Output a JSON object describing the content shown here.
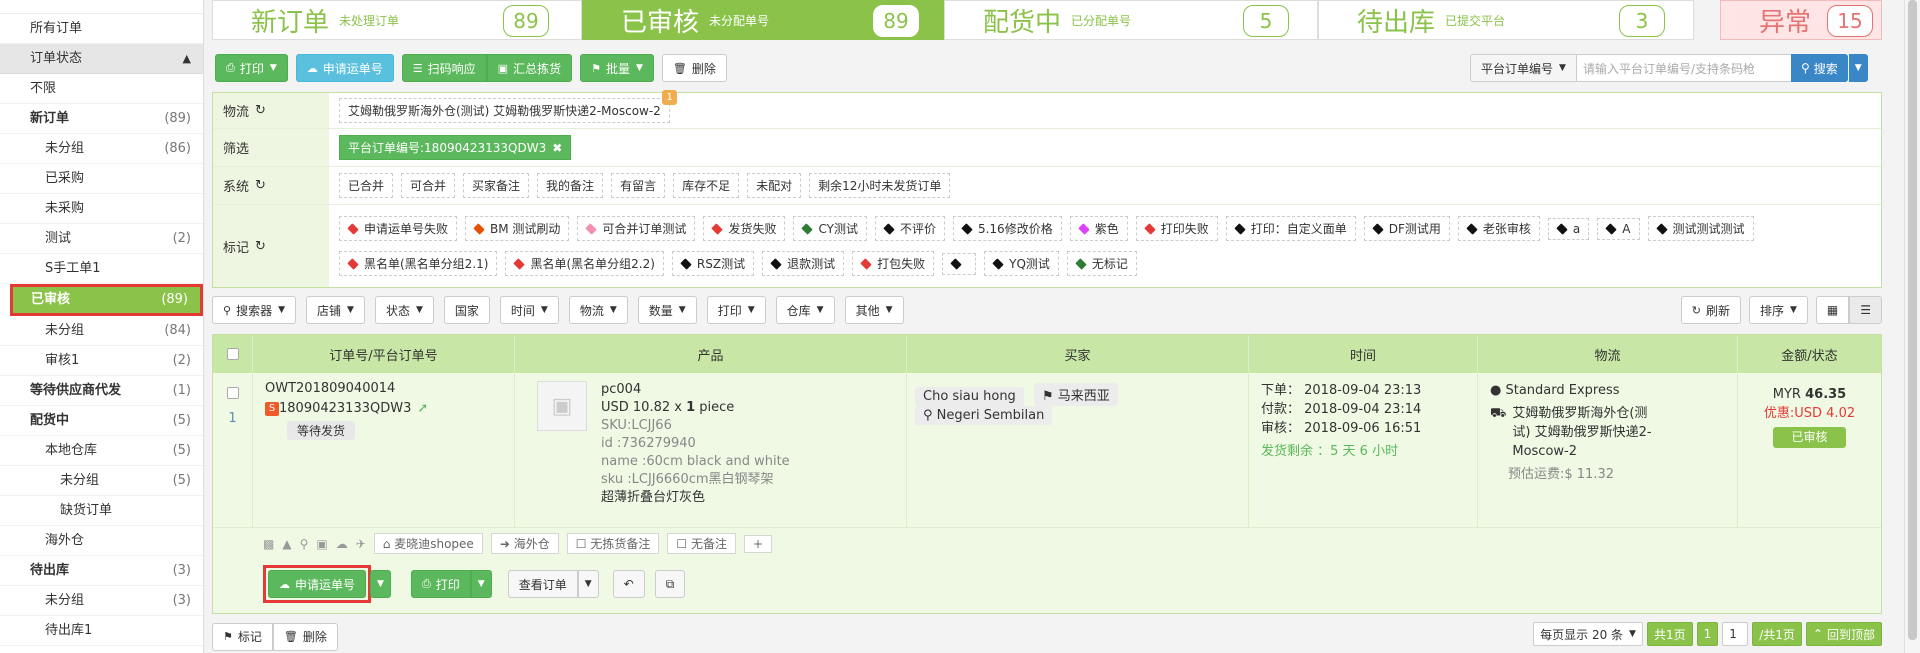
{
  "sidebar": {
    "all_orders": "所有订单",
    "status_header": "订单状态",
    "items": [
      {
        "label": "不限",
        "count": ""
      },
      {
        "label": "新订单",
        "count": "(89)"
      },
      {
        "label": "未分组",
        "count": "(86)"
      },
      {
        "label": "已采购",
        "count": ""
      },
      {
        "label": "未采购",
        "count": ""
      },
      {
        "label": "测试",
        "count": "(2)"
      },
      {
        "label": "S手工单1",
        "count": ""
      },
      {
        "label": "已审核",
        "count": "(89)"
      },
      {
        "label": "未分组",
        "count": "(84)"
      },
      {
        "label": "审核1",
        "count": "(2)"
      },
      {
        "label": "等待供应商代发",
        "count": "(1)"
      },
      {
        "label": "配货中",
        "count": "(5)"
      },
      {
        "label": "本地仓库",
        "count": "(5)"
      },
      {
        "label": "未分组",
        "count": "(5)"
      },
      {
        "label": "缺货订单",
        "count": ""
      },
      {
        "label": "海外仓",
        "count": ""
      },
      {
        "label": "待出库",
        "count": "(3)"
      },
      {
        "label": "未分组",
        "count": "(3)"
      },
      {
        "label": "待出库1",
        "count": ""
      }
    ]
  },
  "tabs": [
    {
      "name": "新订单",
      "sub": "未处理订单",
      "count": "89"
    },
    {
      "name": "已审核",
      "sub": "未分配单号",
      "count": "89"
    },
    {
      "name": "配货中",
      "sub": "已分配单号",
      "count": "5"
    },
    {
      "name": "待出库",
      "sub": "已提交平台",
      "count": "3"
    },
    {
      "name": "异常",
      "sub": "",
      "count": "15"
    }
  ],
  "toolbar": {
    "print": "打印",
    "apply_tracking": "申请运单号",
    "scan_response": "扫码响应",
    "summary_pick": "汇总拣货",
    "batch": "批量",
    "delete": "删除"
  },
  "search": {
    "select_label": "平台订单编号",
    "placeholder": "请输入平台订单编号/支持条码枪",
    "button": "搜索"
  },
  "filters": {
    "logistics_label": "物流",
    "logistics_item": "艾姆勒俄罗斯海外仓(测试) 艾姆勒俄罗斯快递2-Moscow-2",
    "logistics_badge": "1",
    "filter_label": "筛选",
    "filter_selected": "平台订单编号:18090423133QDW3",
    "system_label": "系统",
    "system_items": [
      "已合并",
      "可合并",
      "买家备注",
      "我的备注",
      "有留言",
      "库存不足",
      "未配对",
      "剩余12小时未发货订单"
    ],
    "mark_label": "标记",
    "marks": [
      {
        "text": "申请运单号失败",
        "color": "#e53935"
      },
      {
        "text": "BM 测试刷动",
        "color": "#e65100"
      },
      {
        "text": "可合并订单测试",
        "color": "#f48fb1"
      },
      {
        "text": "发货失败",
        "color": "#e53935"
      },
      {
        "text": "CY测试",
        "color": "#2e7d32"
      },
      {
        "text": "不评价",
        "color": "#111111"
      },
      {
        "text": "5.16修改价格",
        "color": "#111111"
      },
      {
        "text": "紫色",
        "color": "#e040fb"
      },
      {
        "text": "打印失败",
        "color": "#e53935"
      },
      {
        "text": "打印：自定义面单",
        "color": "#111111"
      },
      {
        "text": "DF测试用",
        "color": "#111111"
      },
      {
        "text": "老张审核",
        "color": "#111111"
      },
      {
        "text": "a",
        "color": "#111111"
      },
      {
        "text": "A",
        "color": "#111111"
      },
      {
        "text": "测试测试测试",
        "color": "#111111"
      },
      {
        "text": "黑名单(黑名单分组2.1)",
        "color": "#e53935"
      },
      {
        "text": "黑名单(黑名单分组2.2)",
        "color": "#e53935"
      },
      {
        "text": "RSZ测试",
        "color": "#111111"
      },
      {
        "text": "退款测试",
        "color": "#111111"
      },
      {
        "text": "打包失败",
        "color": "#e53935"
      },
      {
        "text": "",
        "color": "#111111"
      },
      {
        "text": "YQ测试",
        "color": "#111111"
      },
      {
        "text": "无标记",
        "color": "#2e7d32"
      }
    ]
  },
  "filterbar": {
    "items": [
      "搜索器",
      "店铺",
      "状态",
      "国家",
      "时间",
      "物流",
      "数量",
      "打印",
      "仓库",
      "其他"
    ],
    "refresh": "刷新",
    "sort": "排序"
  },
  "table": {
    "headers": [
      "订单号/平台订单号",
      "产品",
      "买家",
      "时间",
      "物流",
      "金额/状态"
    ],
    "row": {
      "index": "1",
      "order_no": "OWT201809040014",
      "platform_no": "18090423133QDW3",
      "status_pill": "等待发货",
      "product_sku_name": "pc004",
      "price_line": "USD 10.82 x",
      "qty": "1",
      "qty_unit": "piece",
      "sku": "SKU:LCJJ66",
      "id": "id :736279940",
      "name": "name :60cm black and white",
      "sku_detail": "sku :LCJJ6660cm黑白钢琴架",
      "product_title": "超薄折叠台灯灰色",
      "buyer_name": "Cho siau hong",
      "buyer_country": "马来西亚",
      "buyer_state": "Negeri Sembilan",
      "time_order": "下单： 2018-09-04 23:13",
      "time_paid": "付款： 2018-09-04 23:14",
      "time_audit": "审核： 2018-09-06 16:51",
      "time_remaining": "发货剩余 ：5 天 6 小时",
      "shipping_method": "Standard Express",
      "logistics_detail": "艾姆勒俄罗斯海外仓(测试) 艾姆勒俄罗斯快递2-Moscow-2",
      "estimated_fee": "预估运费:$ 11.32",
      "amount_currency": "MYR",
      "amount": "46.35",
      "discount": "优惠:USD 4.02",
      "status": "已审核",
      "shop_tag": "麦晓迪shopee",
      "warehouse_tag": "海外仓",
      "no_pick_note": "无拣货备注",
      "no_note": "无备注"
    },
    "actions": {
      "apply_tracking": "申请运单号",
      "print": "打印",
      "view_order": "查看订单"
    }
  },
  "bottom": {
    "mark": "标记",
    "delete": "删除",
    "per_page": "每页显示 20 条",
    "total_pages": "共1页",
    "current_page": "1",
    "page_input": "1",
    "page_suffix": "/共1页",
    "back_top": "回到顶部"
  }
}
